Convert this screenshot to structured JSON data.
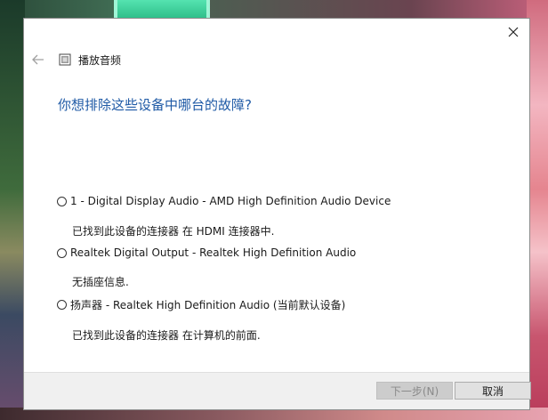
{
  "window": {
    "app_title": "播放音频",
    "heading": "你想排除这些设备中哪台的故障?"
  },
  "options": [
    {
      "label": "1 - Digital Display Audio - AMD High Definition Audio Device",
      "description": "已找到此设备的连接器 在 HDMI 连接器中.",
      "selected": false
    },
    {
      "label": "Realtek Digital Output - Realtek High Definition Audio",
      "description": "无插座信息.",
      "selected": false
    },
    {
      "label": "扬声器 - Realtek High Definition Audio (当前默认设备)",
      "description": "已找到此设备的连接器 在计算机的前面.",
      "selected": false
    }
  ],
  "buttons": {
    "next": "下一步(N)",
    "cancel": "取消"
  },
  "icons": {
    "close": "close-icon",
    "back": "back-arrow-icon",
    "app": "troubleshooter-icon"
  }
}
